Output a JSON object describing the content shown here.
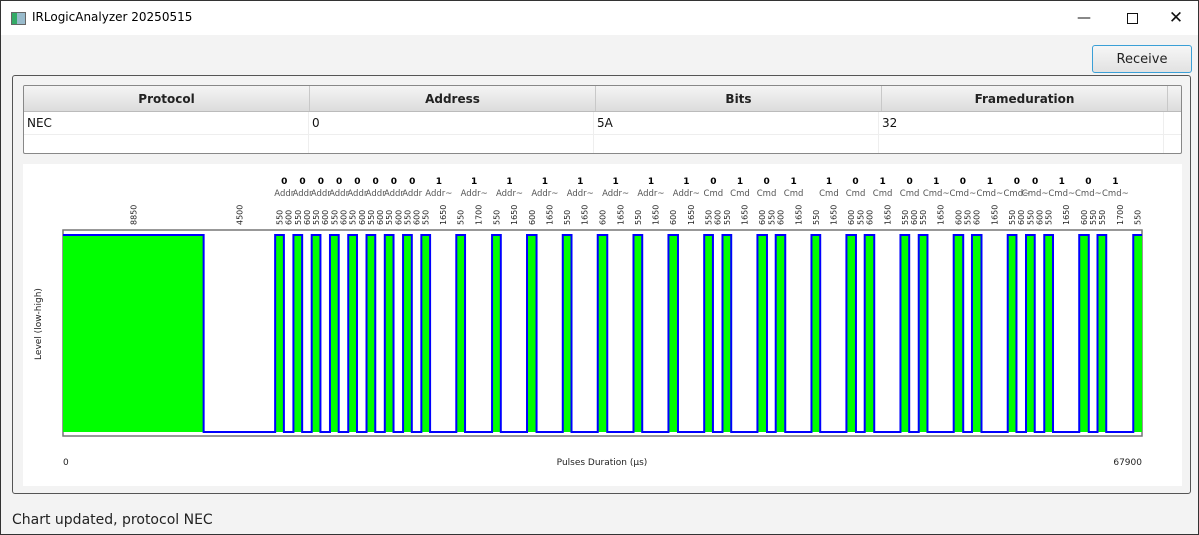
{
  "window": {
    "title": "IRLogicAnalyzer 20250515",
    "minimize_icon": "minimize-icon",
    "maximize_icon": "maximize-icon",
    "close_icon": "close-icon"
  },
  "toolbar": {
    "receive_label": "Receive"
  },
  "table": {
    "columns": [
      "Protocol",
      "Address",
      "Bits",
      "Frameduration"
    ],
    "rows": [
      [
        "NEC",
        "0",
        "5A",
        "32"
      ]
    ]
  },
  "status": "Chart updated, protocol NEC",
  "chart_data": {
    "type": "line",
    "step": true,
    "ylabel": "Level (low-high)",
    "xlabel": "Pulses Duration (µs)",
    "xlim": [
      0,
      67900
    ],
    "x_tick_labels": [
      "0",
      "67900"
    ],
    "colors": {
      "mark_fill": "#00ff00",
      "line": "#0000ff"
    },
    "first_level": "high",
    "durations": [
      8850,
      4500,
      550,
      600,
      550,
      600,
      550,
      600,
      550,
      600,
      550,
      600,
      550,
      600,
      550,
      600,
      550,
      600,
      550,
      1650,
      550,
      1700,
      550,
      1650,
      600,
      1650,
      550,
      1650,
      600,
      1650,
      550,
      1650,
      600,
      1650,
      550,
      600,
      550,
      1650,
      600,
      550,
      600,
      1650,
      550,
      1650,
      600,
      550,
      600,
      1650,
      550,
      600,
      550,
      1650,
      600,
      550,
      600,
      1650,
      550,
      600,
      550,
      600,
      550,
      1650,
      600,
      550,
      550,
      1700,
      550
    ],
    "bits": [
      {
        "value": "0",
        "field": "Addr"
      },
      {
        "value": "0",
        "field": "Addr"
      },
      {
        "value": "0",
        "field": "Addr"
      },
      {
        "value": "0",
        "field": "Addr"
      },
      {
        "value": "0",
        "field": "Addr"
      },
      {
        "value": "0",
        "field": "Addr"
      },
      {
        "value": "0",
        "field": "Addr"
      },
      {
        "value": "0",
        "field": "Addr"
      },
      {
        "value": "1",
        "field": "Addr~"
      },
      {
        "value": "1",
        "field": "Addr~"
      },
      {
        "value": "1",
        "field": "Addr~"
      },
      {
        "value": "1",
        "field": "Addr~"
      },
      {
        "value": "1",
        "field": "Addr~"
      },
      {
        "value": "1",
        "field": "Addr~"
      },
      {
        "value": "1",
        "field": "Addr~"
      },
      {
        "value": "1",
        "field": "Addr~"
      },
      {
        "value": "0",
        "field": "Cmd"
      },
      {
        "value": "1",
        "field": "Cmd"
      },
      {
        "value": "0",
        "field": "Cmd"
      },
      {
        "value": "1",
        "field": "Cmd"
      },
      {
        "value": "1",
        "field": "Cmd"
      },
      {
        "value": "0",
        "field": "Cmd"
      },
      {
        "value": "1",
        "field": "Cmd"
      },
      {
        "value": "0",
        "field": "Cmd"
      },
      {
        "value": "1",
        "field": "Cmd~"
      },
      {
        "value": "0",
        "field": "Cmd~"
      },
      {
        "value": "1",
        "field": "Cmd~"
      },
      {
        "value": "0",
        "field": "Cmd~"
      },
      {
        "value": "0",
        "field": "Cmd~"
      },
      {
        "value": "1",
        "field": "Cmd~"
      },
      {
        "value": "0",
        "field": "Cmd~"
      },
      {
        "value": "1",
        "field": "Cmd~"
      }
    ]
  }
}
